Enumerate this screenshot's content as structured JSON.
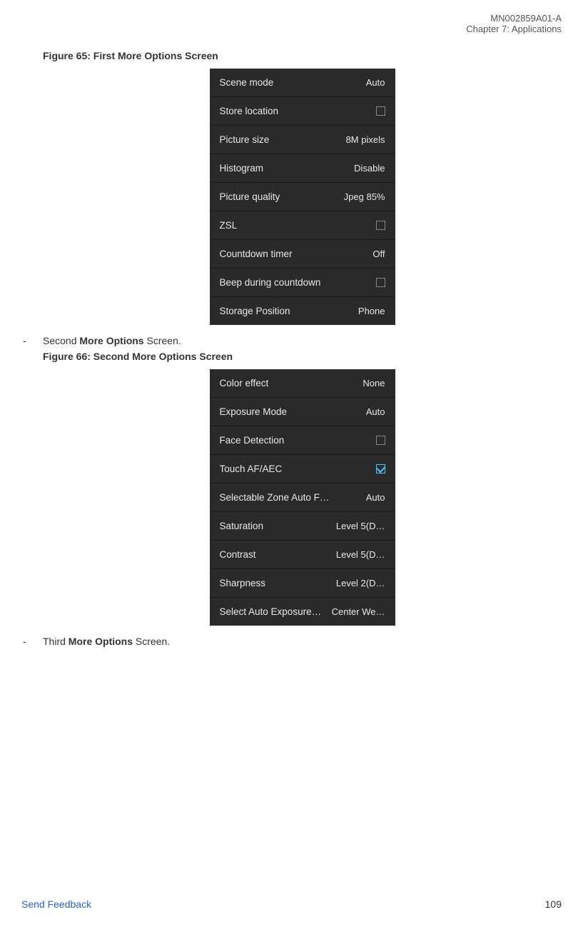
{
  "header": {
    "doc_id": "MN002859A01-A",
    "chapter": "Chapter 7:  Applications"
  },
  "figure65": {
    "caption": "Figure 65: First More Options Screen",
    "rows": [
      {
        "label": "Scene mode",
        "value": "Auto",
        "type": "text"
      },
      {
        "label": "Store location",
        "type": "checkbox",
        "checked": false
      },
      {
        "label": "Picture size",
        "value": "8M pixels",
        "type": "text"
      },
      {
        "label": "Histogram",
        "value": "Disable",
        "type": "text"
      },
      {
        "label": "Picture quality",
        "value": "Jpeg 85%",
        "type": "text"
      },
      {
        "label": "ZSL",
        "type": "checkbox",
        "checked": false
      },
      {
        "label": "Countdown timer",
        "value": "Off",
        "type": "text"
      },
      {
        "label": "Beep during countdown",
        "type": "checkbox",
        "checked": false
      },
      {
        "label": "Storage Position",
        "value": "Phone",
        "type": "text"
      }
    ]
  },
  "bullet1": {
    "prefix": "Second ",
    "bold": "More Options",
    "suffix": " Screen."
  },
  "figure66": {
    "caption": "Figure 66: Second More Options Screen",
    "rows": [
      {
        "label": "Color effect",
        "value": "None",
        "type": "text"
      },
      {
        "label": "Exposure Mode",
        "value": "Auto",
        "type": "text"
      },
      {
        "label": "Face Detection",
        "type": "checkbox",
        "checked": false
      },
      {
        "label": "Touch AF/AEC",
        "type": "checkbox",
        "checked": true
      },
      {
        "label": "Selectable Zone Auto F…",
        "value": "Auto",
        "type": "text"
      },
      {
        "label": "Saturation",
        "value": "Level 5(D…",
        "type": "text"
      },
      {
        "label": "Contrast",
        "value": "Level 5(D…",
        "type": "text"
      },
      {
        "label": "Sharpness",
        "value": "Level 2(D…",
        "type": "text"
      },
      {
        "label": "Select Auto Exposure…",
        "value": "Center We…",
        "type": "text"
      }
    ]
  },
  "bullet2": {
    "prefix": "Third ",
    "bold": "More Options",
    "suffix": " Screen."
  },
  "footer": {
    "link": "Send Feedback",
    "page": "109"
  }
}
